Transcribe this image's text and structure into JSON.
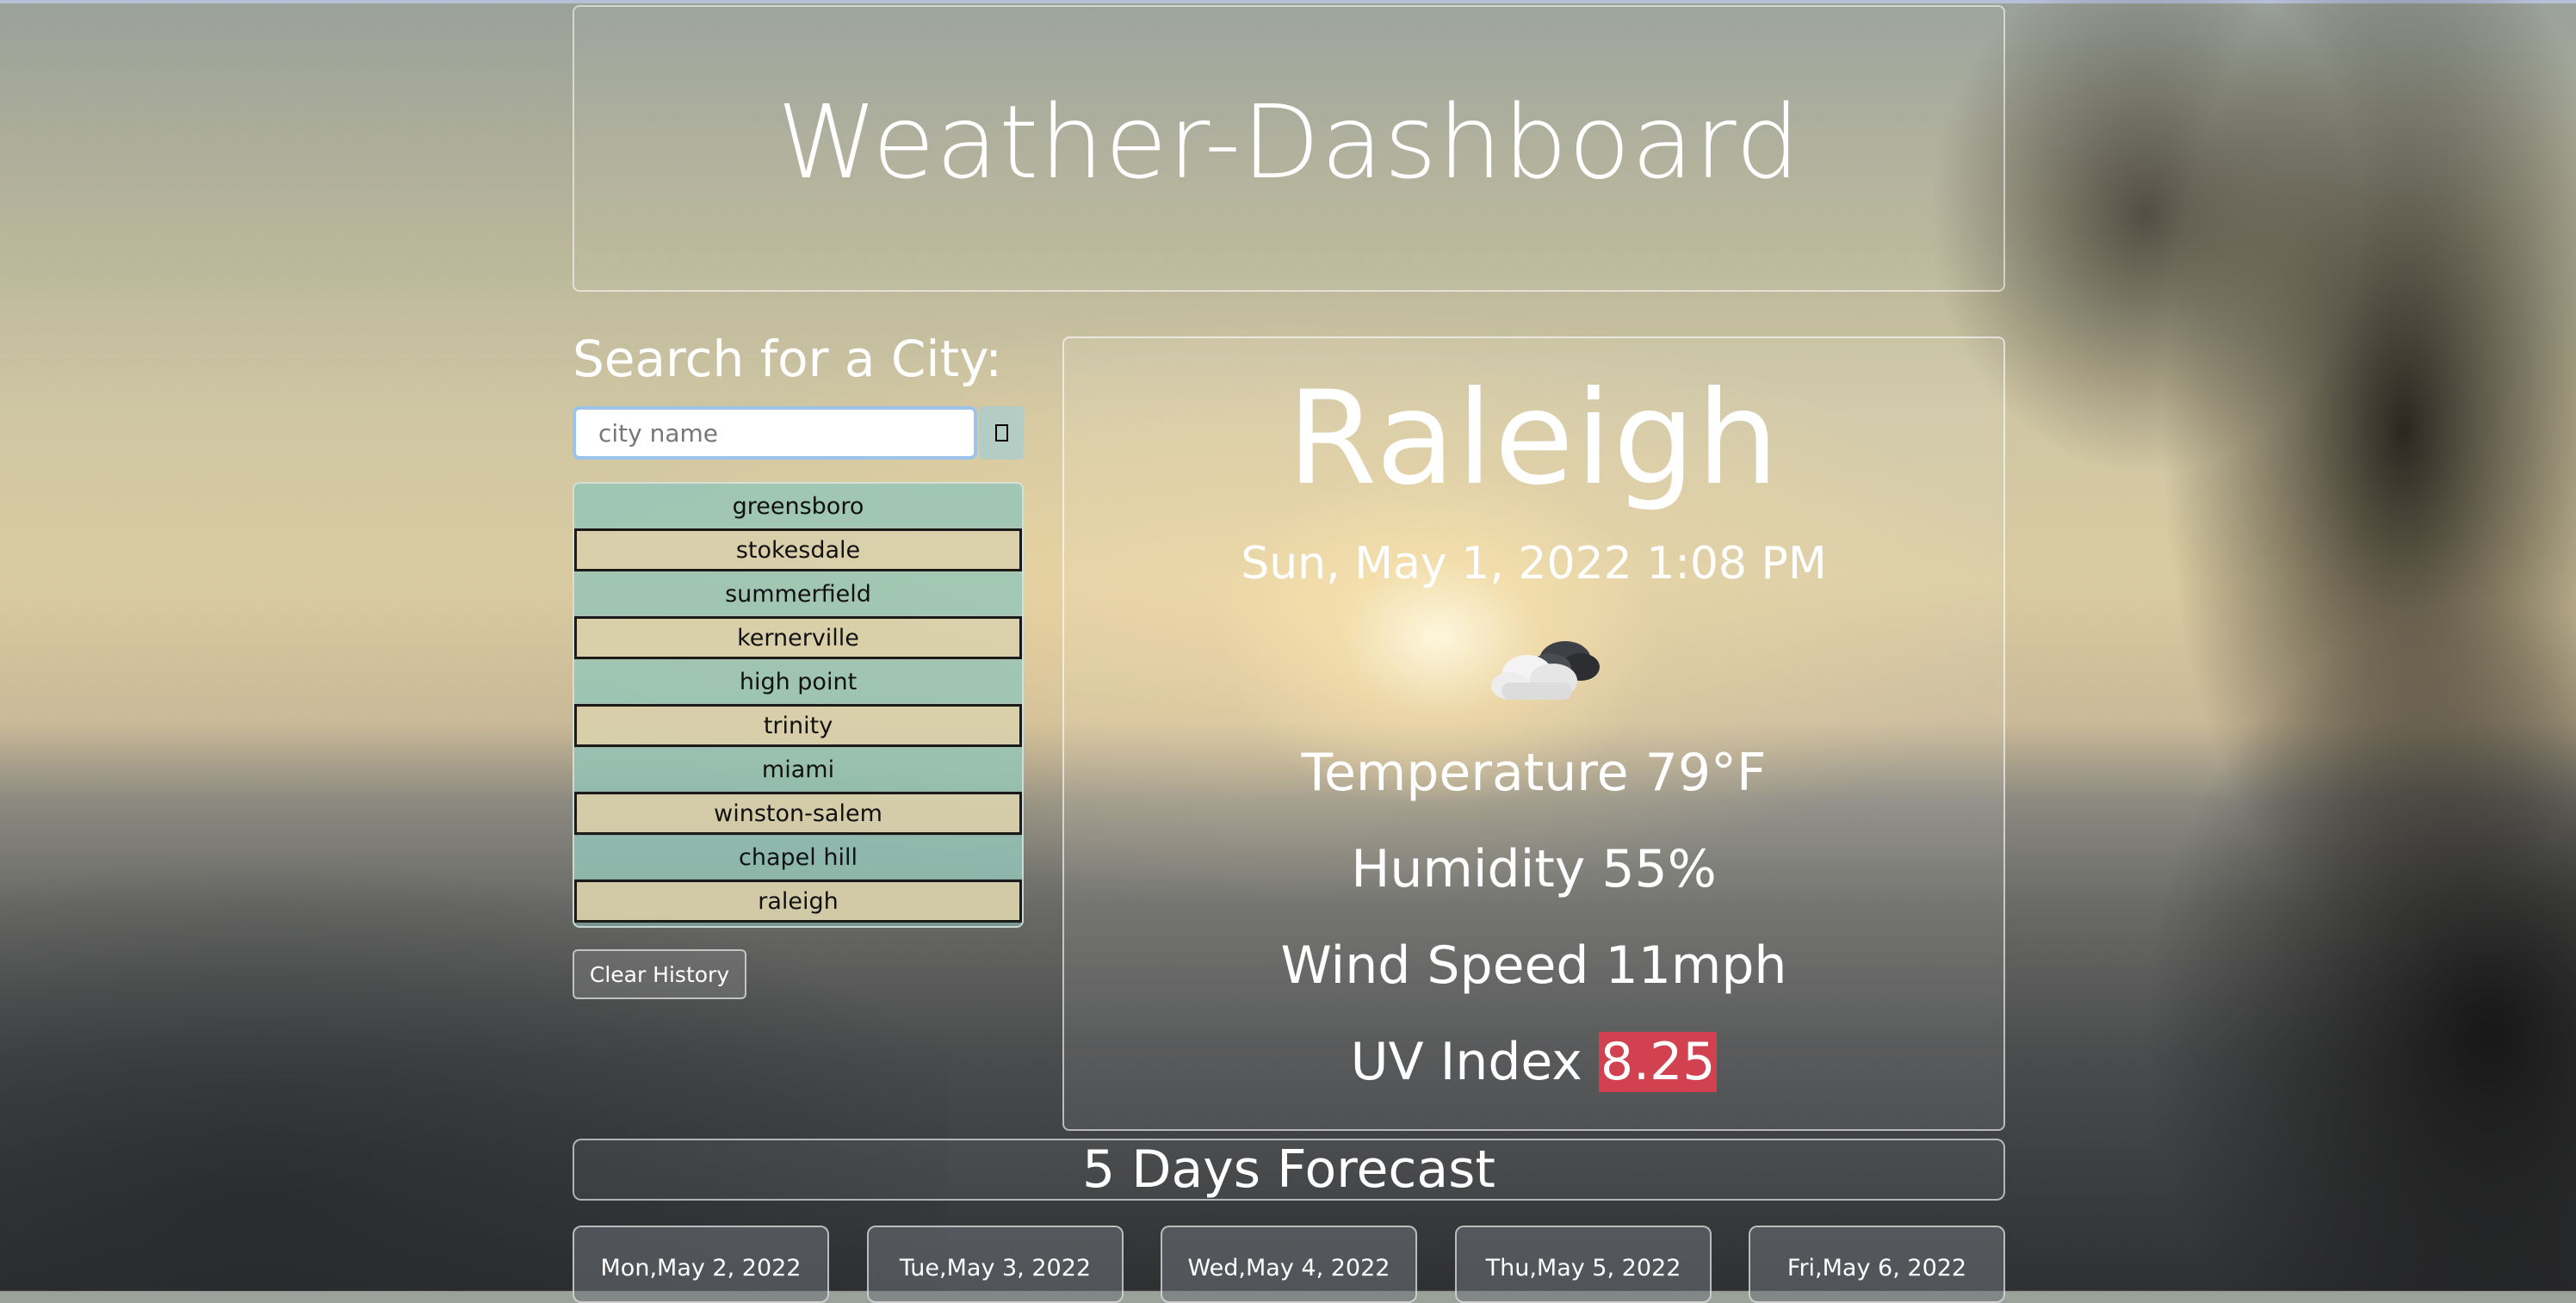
{
  "header": {
    "title": "Weather-Dashboard"
  },
  "search": {
    "title": "Search for a City:",
    "placeholder": "city name",
    "button_icon": "search-icon"
  },
  "history": {
    "items": [
      "greensboro",
      "stokesdale",
      "summerfield",
      "kernerville",
      "high point",
      "trinity",
      "miami",
      "winston-salem",
      "chapel hill",
      "raleigh"
    ],
    "clear_label": "Clear History"
  },
  "current": {
    "city": "Raleigh",
    "datetime": "Sun, May 1, 2022 1:08 PM",
    "icon": "cloud-icon",
    "temperature": "Temperature 79°F",
    "humidity": "Humidity 55%",
    "wind": "Wind Speed 11mph",
    "uv_label": "UV Index ",
    "uv_value": "8.25",
    "uv_color": "#d2414f"
  },
  "forecast": {
    "title": "5 Days Forecast",
    "days": [
      "Mon,May 2, 2022",
      "Tue,May 3, 2022",
      "Wed,May 4, 2022",
      "Thu,May 5, 2022",
      "Fri,May 6, 2022"
    ]
  }
}
